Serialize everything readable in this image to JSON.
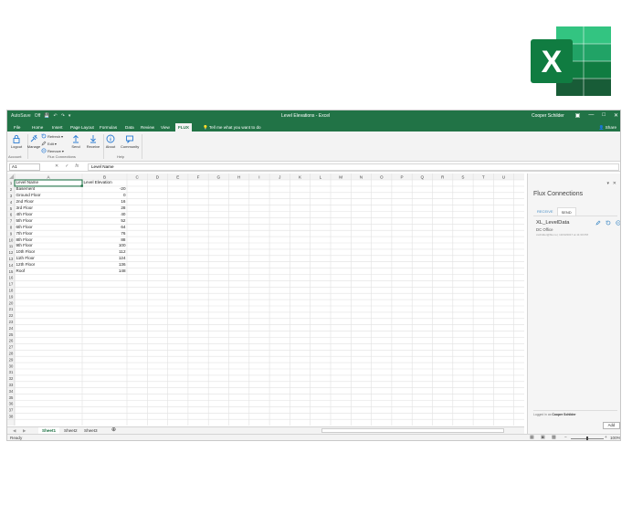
{
  "window": {
    "title": "Level Elevations - Excel",
    "user": "Cooper Schilder",
    "autosave": "AutoSave",
    "autosave_state": "Off"
  },
  "tabs": [
    "File",
    "Home",
    "Insert",
    "Page Layout",
    "Formulas",
    "Data",
    "Review",
    "View",
    "FLUX"
  ],
  "active_tab": "FLUX",
  "tell_me": "Tell me what you want to do",
  "share": "Share",
  "ribbon": {
    "account": {
      "label": "Account",
      "buttons": [
        {
          "label": "Logout",
          "icon": "lock-icon"
        }
      ]
    },
    "connections": {
      "label": "Flux Connections",
      "buttons": [
        {
          "label": "Manage",
          "icon": "plug-icon"
        }
      ],
      "small": [
        {
          "label": "Refresh",
          "icon": "refresh-icon"
        },
        {
          "label": "Edit",
          "icon": "pencil-icon"
        },
        {
          "label": "Remove",
          "icon": "remove-icon"
        }
      ],
      "send": {
        "label": "Send",
        "icon": "upload-icon"
      },
      "receive": {
        "label": "Receive",
        "icon": "download-icon"
      }
    },
    "help": {
      "label": "Help",
      "buttons": [
        {
          "label": "About",
          "icon": "info-icon"
        },
        {
          "label": "Community",
          "icon": "chat-icon"
        }
      ]
    }
  },
  "formula_bar": {
    "name_box": "A1",
    "content": "Level Name"
  },
  "sheet": {
    "columns": [
      "A",
      "B",
      "C",
      "D",
      "E",
      "F",
      "G",
      "H",
      "I",
      "J",
      "K",
      "L",
      "M",
      "N",
      "O",
      "P",
      "Q",
      "R",
      "S",
      "T",
      "U"
    ],
    "rows": [
      [
        "Level Name",
        "Level Elevation"
      ],
      [
        "Basement",
        "-20"
      ],
      [
        "Ground Floor",
        "0"
      ],
      [
        "2nd Floor",
        "16"
      ],
      [
        "3rd Floor",
        "28"
      ],
      [
        "4th Floor",
        "40"
      ],
      [
        "5th Floor",
        "52"
      ],
      [
        "6th Floor",
        "64"
      ],
      [
        "7th Floor",
        "76"
      ],
      [
        "8th Floor",
        "88"
      ],
      [
        "9th Floor",
        "100"
      ],
      [
        "10th Floor",
        "112"
      ],
      [
        "11th Floor",
        "124"
      ],
      [
        "12th Floor",
        "136"
      ],
      [
        "Roof",
        "148"
      ]
    ],
    "row_count": 38
  },
  "sheet_tabs": [
    "Sheet1",
    "Sheet2",
    "Sheet3"
  ],
  "active_sheet": "Sheet1",
  "status": {
    "ready": "Ready",
    "zoom": "100%"
  },
  "pane": {
    "title": "Flux Connections",
    "tabs": [
      "RECEIVE",
      "SEND"
    ],
    "active_tab": "SEND",
    "item": {
      "name": "XL_LevelData",
      "subtitle": "DC Office",
      "meta": "cschilder@flux.io | 10/13/2017 at 11:30 PM"
    },
    "logged_in_label": "Logged in as",
    "logged_in_user": "Cooper Schilder",
    "add_label": "Add"
  },
  "colors": {
    "accent": "#217346",
    "grid": "#e1e1e1",
    "header_bg": "#f3f3f3",
    "link": "#4a90c8"
  }
}
